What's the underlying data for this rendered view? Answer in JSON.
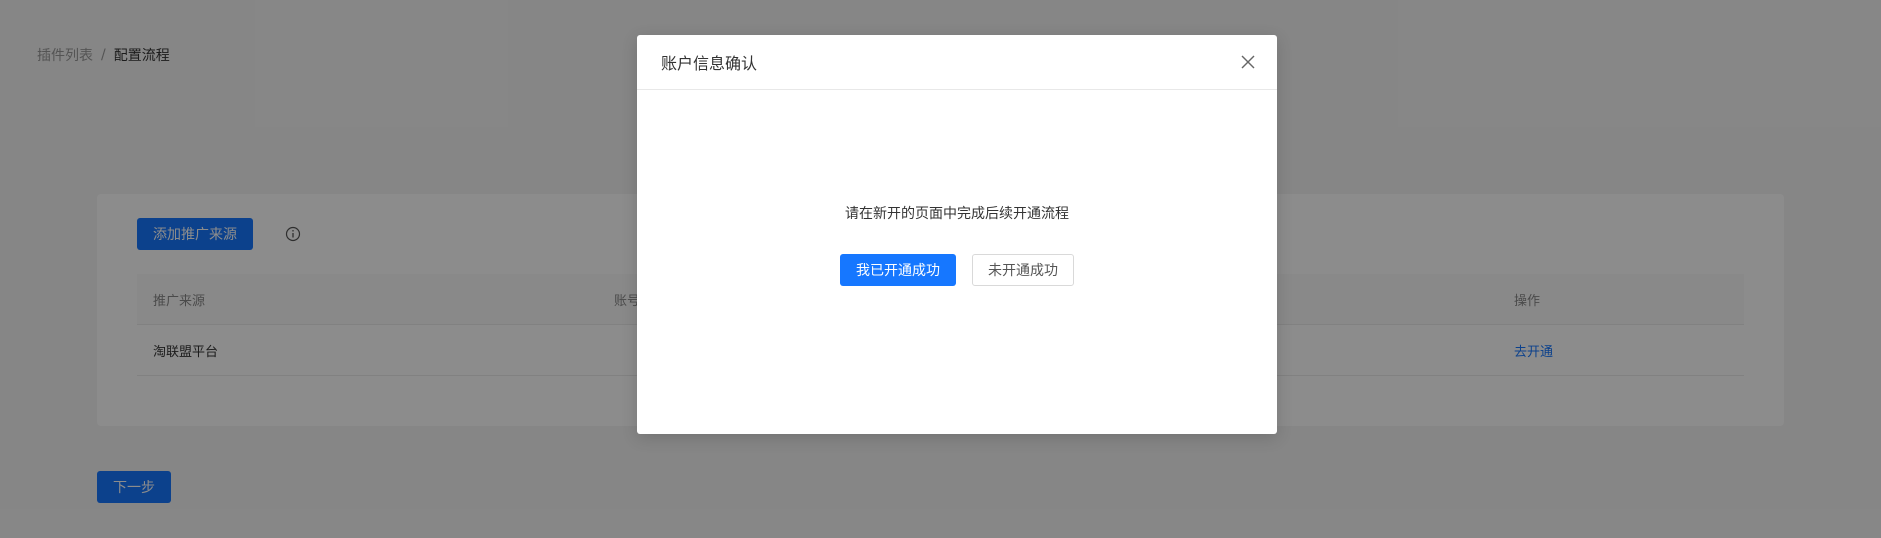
{
  "breadcrumb": {
    "items": [
      "插件列表",
      "配置流程"
    ],
    "separator": "/"
  },
  "toolbar": {
    "add_source_label": "添加推广来源"
  },
  "table": {
    "columns": [
      "推广来源",
      "账号",
      "操作"
    ],
    "rows": [
      {
        "source": "淘联盟平台",
        "account": "",
        "action": "去开通"
      }
    ]
  },
  "footer": {
    "next_label": "下一步"
  },
  "modal": {
    "title": "账户信息确认",
    "message": "请在新开的页面中完成后续开通流程",
    "confirm_label": "我已开通成功",
    "cancel_label": "未开通成功"
  },
  "colors": {
    "primary": "#1677ff",
    "overlay": "rgba(0,0,0,0.45)"
  },
  "icons": {
    "info": "info-circle-icon",
    "close": "close-icon"
  }
}
